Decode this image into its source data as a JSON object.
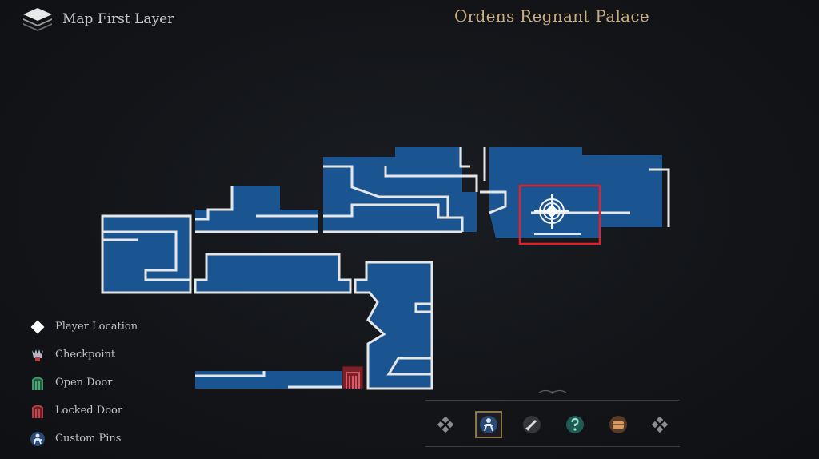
{
  "header": {
    "layer_label": "Map First Layer",
    "area_title": "Ordens Regnant Palace"
  },
  "legend": [
    {
      "icon": "player-location-icon",
      "label": "Player Location",
      "color": "#ffffff"
    },
    {
      "icon": "checkpoint-icon",
      "label": "Checkpoint",
      "color": "#b6b6c8"
    },
    {
      "icon": "open-door-icon",
      "label": "Open Door",
      "color": "#3f9a66"
    },
    {
      "icon": "locked-door-icon",
      "label": "Locked Door",
      "color": "#b53d45"
    },
    {
      "icon": "custom-pins-icon",
      "label": "Custom Pins",
      "color": "#8fb7e0"
    }
  ],
  "toolbar": {
    "items": [
      {
        "name": "prev-filter-icon"
      },
      {
        "name": "custom-pin-filter-icon",
        "active": true
      },
      {
        "name": "weapon-filter-icon"
      },
      {
        "name": "question-filter-icon"
      },
      {
        "name": "chest-filter-icon"
      },
      {
        "name": "next-filter-icon"
      }
    ]
  },
  "colors": {
    "room_fill": "#1a5591",
    "wall": "#e6e6e6",
    "highlight_box": "#e0202a",
    "title": "#c9ad7e"
  }
}
